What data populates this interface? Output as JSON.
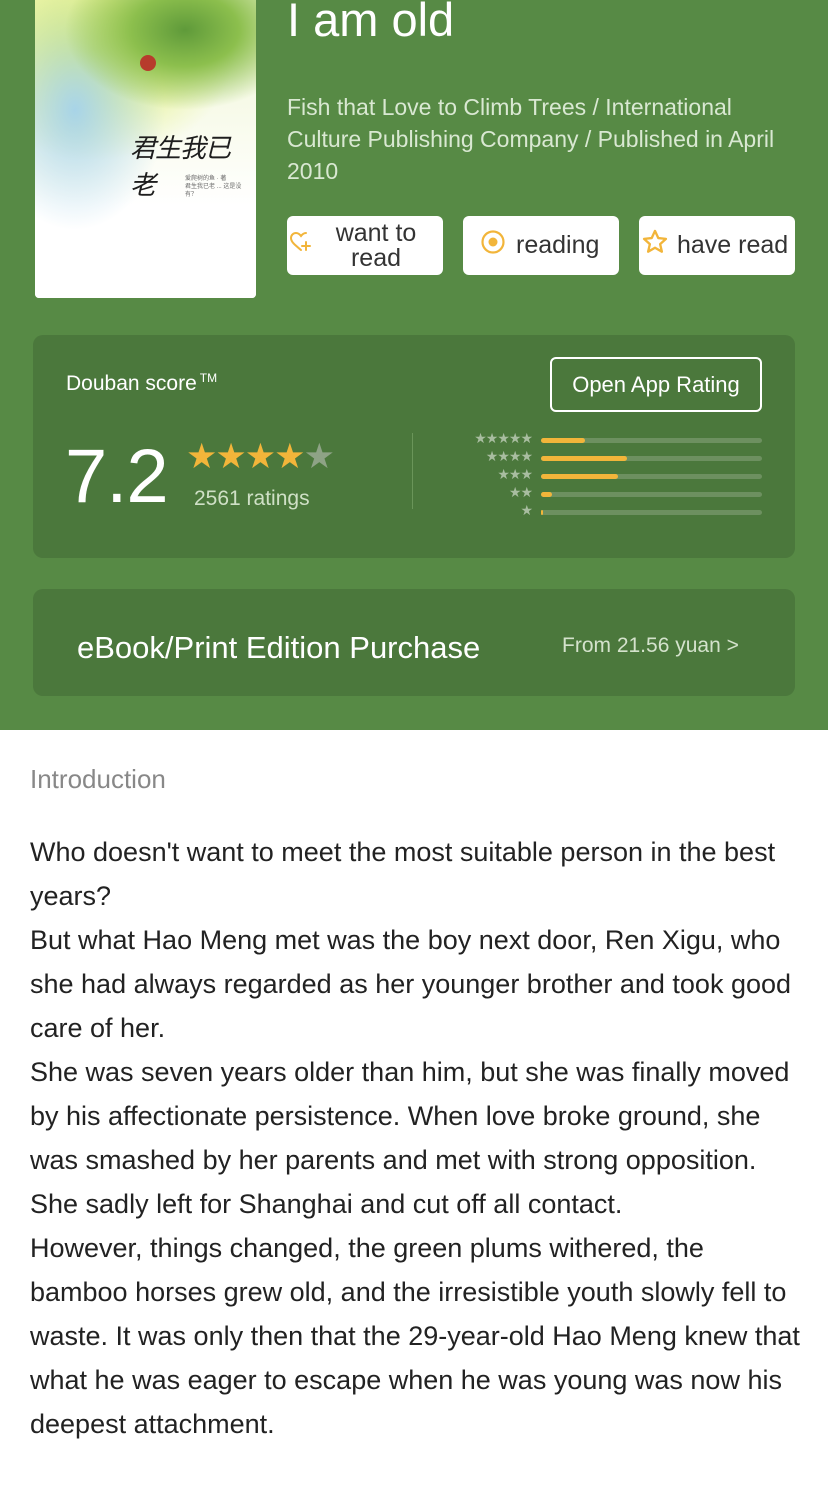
{
  "book": {
    "title": "I am old",
    "meta": "Fish that Love to Climb Trees / International Culture Publishing Company / Published in April 2010",
    "cover_title": "君生我已老",
    "cover_author": "爱爬树的鱼 · 著",
    "cover_tagline": "君生我已老 ... 这是没有？"
  },
  "actions": {
    "want_to_read": "want to read",
    "reading": "reading",
    "have_read": "have read"
  },
  "score": {
    "label": "Douban score",
    "trademark": "TM",
    "open_app_label": "Open App Rating",
    "value": "7.2",
    "stars_filled": 4,
    "stars_total": 5,
    "ratings_text": "2561 ratings",
    "distribution": [
      {
        "stars": 5,
        "fraction": 0.2
      },
      {
        "stars": 4,
        "fraction": 0.39
      },
      {
        "stars": 3,
        "fraction": 0.35
      },
      {
        "stars": 2,
        "fraction": 0.05
      },
      {
        "stars": 1,
        "fraction": 0.01
      }
    ],
    "colors": {
      "accent": "#f2b53a",
      "header": "#578a45",
      "card": "#4b783c"
    }
  },
  "purchase": {
    "label": "eBook/Print Edition Purchase",
    "price": "From 21.56 yuan >"
  },
  "intro": {
    "heading": "Introduction",
    "paragraphs": [
      "Who doesn't want to meet the most suitable person in the best years?",
      "But what Hao Meng met was the boy next door, Ren Xigu, who she had always regarded as her younger brother and took good care of her.",
      "She was seven years older than him, but she was finally moved by his affectionate persistence. When love broke ground, she was smashed by her parents and met with strong opposition. She sadly left for Shanghai and cut off all contact.",
      "However, things changed, the green plums withered, the bamboo horses grew old, and the irresistible youth slowly fell to waste. It was only then that the 29-year-old Hao Meng knew that what he was eager to escape when he was young was now his deepest attachment."
    ]
  }
}
